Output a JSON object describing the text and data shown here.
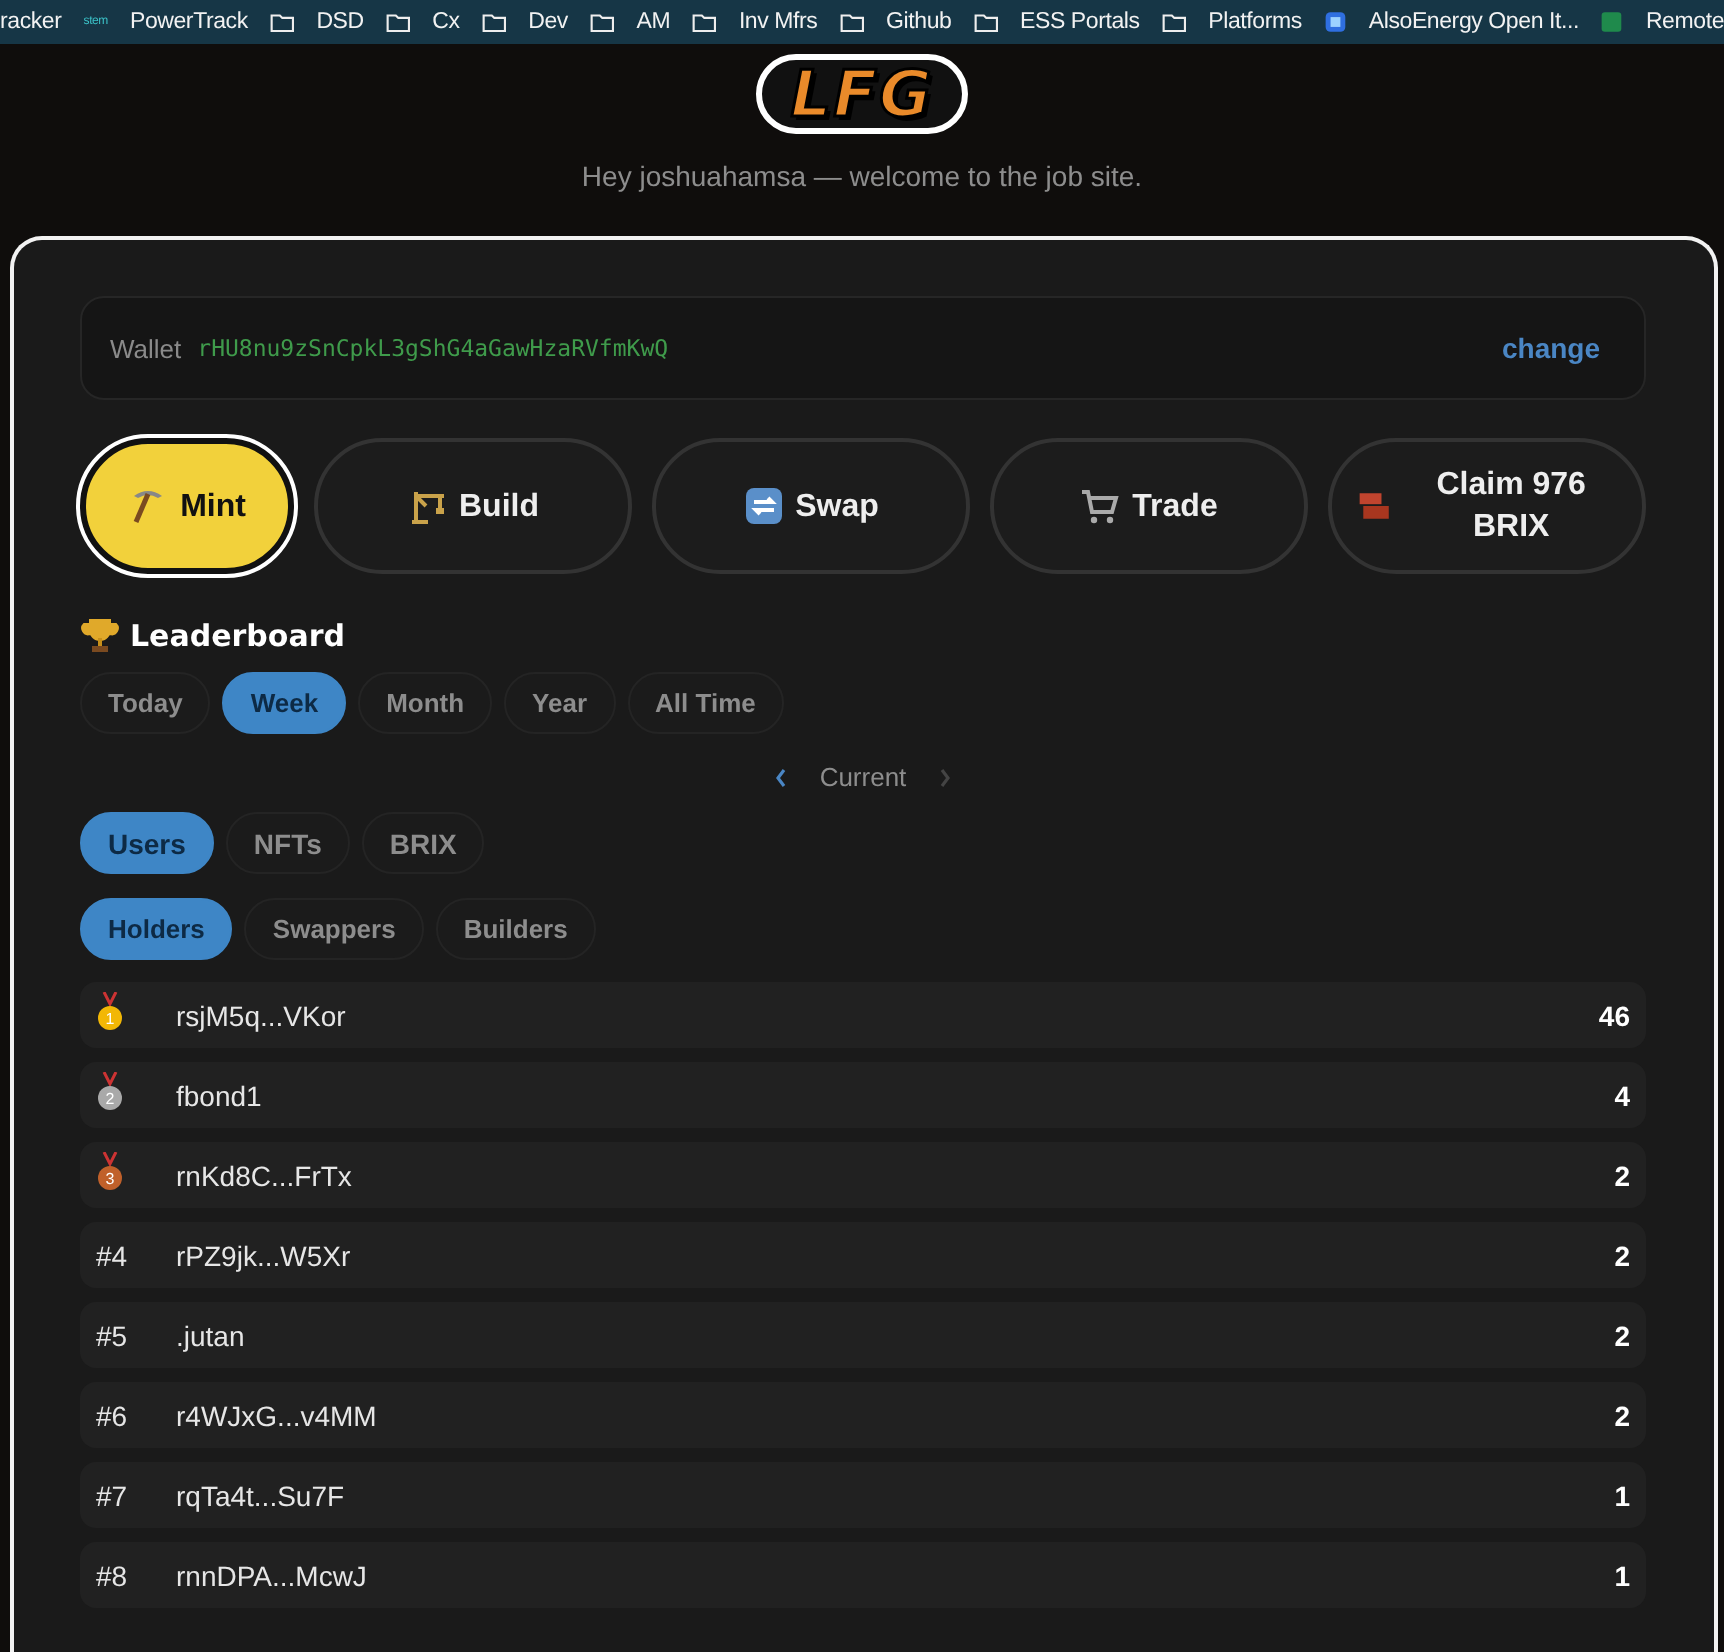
{
  "bookmarks": [
    {
      "kind": "plain",
      "label": "racker"
    },
    {
      "kind": "site",
      "logo_text": "stem",
      "label": "PowerTrack"
    },
    {
      "kind": "folder",
      "label": "DSD"
    },
    {
      "kind": "folder",
      "label": "Cx"
    },
    {
      "kind": "folder",
      "label": "Dev"
    },
    {
      "kind": "folder",
      "label": "AM"
    },
    {
      "kind": "folder",
      "label": "Inv Mfrs"
    },
    {
      "kind": "folder",
      "label": "Github"
    },
    {
      "kind": "folder",
      "label": "ESS Portals"
    },
    {
      "kind": "folder",
      "label": "Platforms"
    },
    {
      "kind": "app",
      "label": "AlsoEnergy Open It..."
    },
    {
      "kind": "sheet",
      "label": "Remote"
    }
  ],
  "header": {
    "logo": "LFG",
    "greeting": "Hey joshuahamsa — welcome to the job site."
  },
  "wallet": {
    "label": "Wallet",
    "address": "rHU8nu9zSnCpkL3gShG4aGawHzaRVfmKwQ",
    "action": "change"
  },
  "actions": [
    {
      "kind": "pickaxe",
      "label": "Mint",
      "selected": true
    },
    {
      "kind": "crane",
      "label": "Build",
      "selected": false
    },
    {
      "kind": "swap",
      "label": "Swap",
      "selected": false
    },
    {
      "kind": "cart",
      "label": "Trade",
      "selected": false
    },
    {
      "kind": "brick",
      "label": "Claim 976 BRIX",
      "selected": false
    }
  ],
  "leaderboard": {
    "title": "Leaderboard",
    "periods": [
      {
        "label": "Today",
        "selected": false
      },
      {
        "label": "Week",
        "selected": true
      },
      {
        "label": "Month",
        "selected": false
      },
      {
        "label": "Year",
        "selected": false
      },
      {
        "label": "All Time",
        "selected": false
      }
    ],
    "period_nav": {
      "label": "Current",
      "prev_disabled": false,
      "next_disabled": true
    },
    "categories": [
      {
        "label": "Users",
        "selected": true
      },
      {
        "label": "NFTs",
        "selected": false
      },
      {
        "label": "BRIX",
        "selected": false
      }
    ],
    "types": [
      {
        "label": "Holders",
        "selected": true
      },
      {
        "label": "Swappers",
        "selected": false
      },
      {
        "label": "Builders",
        "selected": false
      }
    ],
    "rows": [
      {
        "kind": "medal",
        "color": "#f2b705",
        "medal_number": "1",
        "name": "rsjM5q...VKor",
        "score": "46"
      },
      {
        "kind": "medal",
        "color": "#a9a9a9",
        "medal_number": "2",
        "name": "fbond1",
        "score": "4"
      },
      {
        "kind": "medal",
        "color": "#c0602a",
        "medal_number": "3",
        "name": "rnKd8C...FrTx",
        "score": "2"
      },
      {
        "kind": "number",
        "rank": "#4",
        "name": "rPZ9jk...W5Xr",
        "score": "2"
      },
      {
        "kind": "number",
        "rank": "#5",
        "name": ".jutan",
        "score": "2"
      },
      {
        "kind": "number",
        "rank": "#6",
        "name": "r4WJxG...v4MM",
        "score": "2"
      },
      {
        "kind": "number",
        "rank": "#7",
        "name": "rqTa4t...Su7F",
        "score": "1"
      },
      {
        "kind": "number",
        "rank": "#8",
        "name": "rnnDPA...McwJ",
        "score": "1"
      }
    ]
  }
}
